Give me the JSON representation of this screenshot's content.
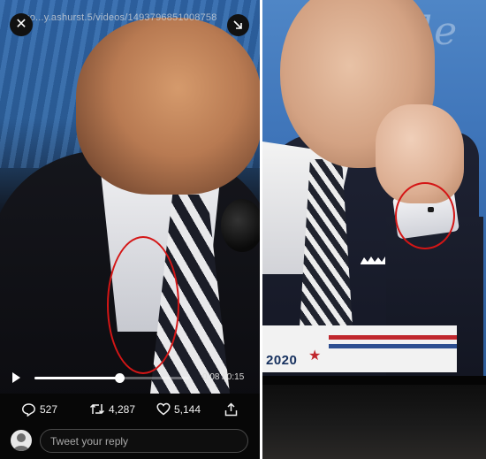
{
  "left_panel": {
    "url": "co...y.ashurst.5/videos/1493796851008758",
    "player": {
      "progress_fraction": 0.55,
      "time_label": "0:08 / 0:15"
    },
    "actions": {
      "replies": "527",
      "retweets": "4,287",
      "likes": "5,144"
    },
    "reply": {
      "placeholder": "Tweet your reply"
    },
    "icons": [
      "close-icon",
      "shrink-icon",
      "play-icon",
      "reply-icon",
      "retweet-icon",
      "heart-icon",
      "share-icon",
      "avatar-icon"
    ],
    "annotation_color": "#d41616"
  },
  "right_panel": {
    "banner_text": "2020",
    "banner_star": "★",
    "bg_text": "ele",
    "annotation_color": "#d41616"
  }
}
